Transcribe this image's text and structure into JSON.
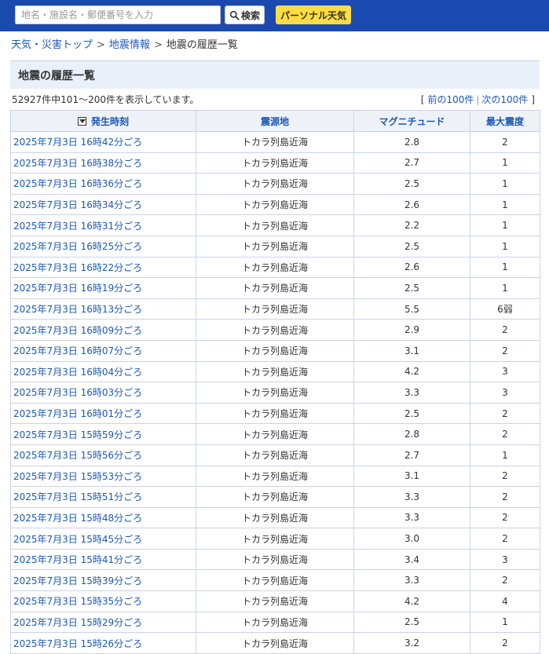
{
  "header": {
    "search_placeholder": "地名・施設名・郵便番号を入力",
    "search_button": "検索",
    "personal_button": "パーソナル天気"
  },
  "breadcrumb": {
    "item1": "天気・災害トップ",
    "item2": "地震情報",
    "current": "地震の履歴一覧",
    "separator": ">"
  },
  "page_title": "地震の履歴一覧",
  "summary": "52927件中101～200件を表示しています。",
  "pager": {
    "prev": "前の100件",
    "next": "次の100件",
    "open": "[",
    "close": "]",
    "divider": "|"
  },
  "table": {
    "headers": [
      "発生時刻",
      "震源地",
      "マグニチュード",
      "最大震度"
    ],
    "rows": [
      [
        "2025年7月3日 16時42分ごろ",
        "トカラ列島近海",
        "2.8",
        "2"
      ],
      [
        "2025年7月3日 16時38分ごろ",
        "トカラ列島近海",
        "2.7",
        "1"
      ],
      [
        "2025年7月3日 16時36分ごろ",
        "トカラ列島近海",
        "2.5",
        "1"
      ],
      [
        "2025年7月3日 16時34分ごろ",
        "トカラ列島近海",
        "2.6",
        "1"
      ],
      [
        "2025年7月3日 16時31分ごろ",
        "トカラ列島近海",
        "2.2",
        "1"
      ],
      [
        "2025年7月3日 16時25分ごろ",
        "トカラ列島近海",
        "2.5",
        "1"
      ],
      [
        "2025年7月3日 16時22分ごろ",
        "トカラ列島近海",
        "2.6",
        "1"
      ],
      [
        "2025年7月3日 16時19分ごろ",
        "トカラ列島近海",
        "2.5",
        "1"
      ],
      [
        "2025年7月3日 16時13分ごろ",
        "トカラ列島近海",
        "5.5",
        "6弱"
      ],
      [
        "2025年7月3日 16時09分ごろ",
        "トカラ列島近海",
        "2.9",
        "2"
      ],
      [
        "2025年7月3日 16時07分ごろ",
        "トカラ列島近海",
        "3.1",
        "2"
      ],
      [
        "2025年7月3日 16時04分ごろ",
        "トカラ列島近海",
        "4.2",
        "3"
      ],
      [
        "2025年7月3日 16時03分ごろ",
        "トカラ列島近海",
        "3.3",
        "3"
      ],
      [
        "2025年7月3日 16時01分ごろ",
        "トカラ列島近海",
        "2.5",
        "2"
      ],
      [
        "2025年7月3日 15時59分ごろ",
        "トカラ列島近海",
        "2.8",
        "2"
      ],
      [
        "2025年7月3日 15時56分ごろ",
        "トカラ列島近海",
        "2.7",
        "1"
      ],
      [
        "2025年7月3日 15時53分ごろ",
        "トカラ列島近海",
        "3.1",
        "2"
      ],
      [
        "2025年7月3日 15時51分ごろ",
        "トカラ列島近海",
        "3.3",
        "2"
      ],
      [
        "2025年7月3日 15時48分ごろ",
        "トカラ列島近海",
        "3.3",
        "2"
      ],
      [
        "2025年7月3日 15時45分ごろ",
        "トカラ列島近海",
        "3.0",
        "2"
      ],
      [
        "2025年7月3日 15時41分ごろ",
        "トカラ列島近海",
        "3.4",
        "3"
      ],
      [
        "2025年7月3日 15時39分ごろ",
        "トカラ列島近海",
        "3.3",
        "2"
      ],
      [
        "2025年7月3日 15時35分ごろ",
        "トカラ列島近海",
        "4.2",
        "4"
      ],
      [
        "2025年7月3日 15時29分ごろ",
        "トカラ列島近海",
        "2.5",
        "1"
      ],
      [
        "2025年7月3日 15時26分ごろ",
        "トカラ列島近海",
        "3.2",
        "2"
      ]
    ]
  },
  "colors": {
    "topbar": "#1a4ab0",
    "personal_button": "#ffdc43",
    "link": "#1c59b5",
    "heading_bg": "#eaf0fa",
    "table_border": "#c9d3e6"
  }
}
